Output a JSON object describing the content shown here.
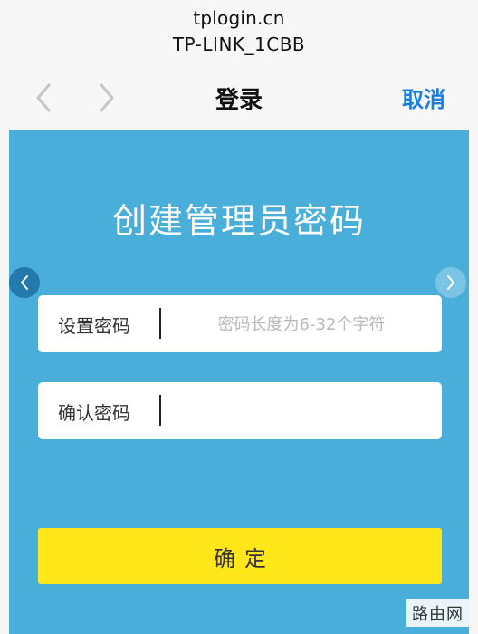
{
  "browser": {
    "host": "tplogin.cn",
    "network_name": "TP-LINK_1CBB"
  },
  "nav": {
    "title": "登录",
    "cancel_label": "取消",
    "back_icon": "chevron-left-icon",
    "forward_icon": "chevron-right-icon"
  },
  "main": {
    "heading": "创建管理员密码",
    "password_label": "设置密码",
    "password_placeholder": "密码长度为6-32个字符",
    "confirm_label": "确认密码",
    "confirm_value": "",
    "submit_label": "确定",
    "side_left_icon": "chevron-left-icon",
    "side_right_icon": "chevron-right-icon"
  },
  "watermark": {
    "text": "路由网"
  },
  "colors": {
    "panel_bg": "#4aaedb",
    "accent_blue": "#1b7ee0",
    "button_yellow": "#ffe71a"
  }
}
